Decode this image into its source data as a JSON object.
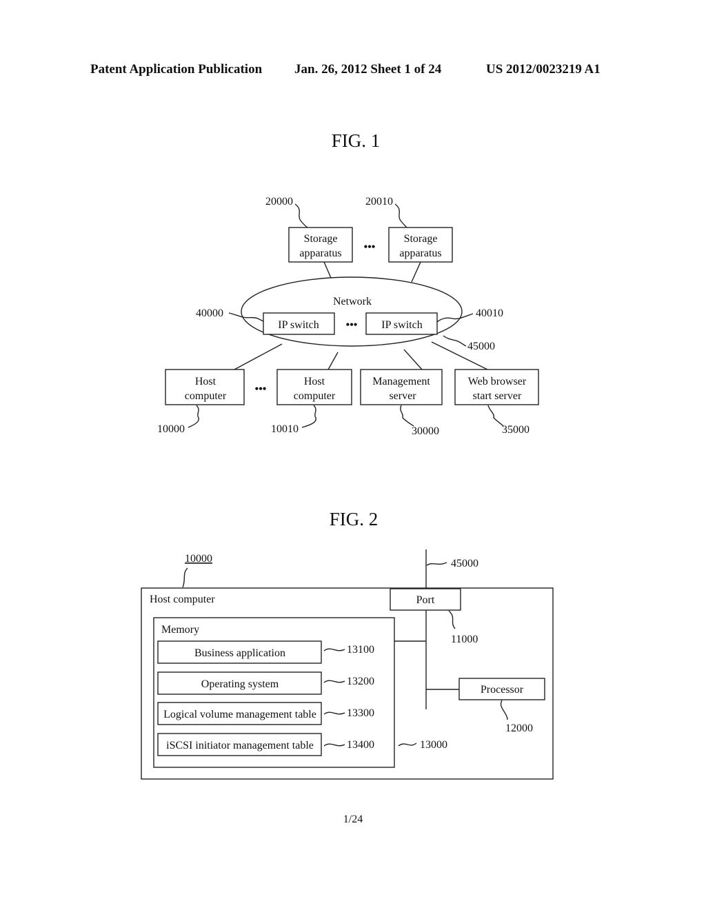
{
  "header": {
    "publication": "Patent Application Publication",
    "date_sheet": "Jan. 26, 2012  Sheet 1 of 24",
    "number": "US 2012/0023219 A1"
  },
  "fig1": {
    "title": "FIG. 1",
    "storage": [
      {
        "line1": "Storage",
        "line2": "apparatus",
        "ref": "20000"
      },
      {
        "line1": "Storage",
        "line2": "apparatus",
        "ref": "20010"
      }
    ],
    "network": {
      "label": "Network",
      "ref": "45000"
    },
    "switches": [
      {
        "label": "IP switch",
        "ref": "40000"
      },
      {
        "label": "IP switch",
        "ref": "40010"
      }
    ],
    "nodes": [
      {
        "line1": "Host",
        "line2": "computer",
        "ref": "10000"
      },
      {
        "line1": "Host",
        "line2": "computer",
        "ref": "10010"
      },
      {
        "line1": "Management",
        "line2": "server",
        "ref": "30000"
      },
      {
        "line1": "Web browser",
        "line2": "start server",
        "ref": "35000"
      }
    ],
    "ellipsis": "•••"
  },
  "fig2": {
    "title": "FIG. 2",
    "host": {
      "label": "Host computer",
      "ref": "10000"
    },
    "port": {
      "label": "Port",
      "ref": "11000"
    },
    "network_ref": "45000",
    "processor": {
      "label": "Processor",
      "ref": "12000"
    },
    "memory": {
      "label": "Memory",
      "ref": "13000",
      "items": [
        {
          "label": "Business application",
          "ref": "13100"
        },
        {
          "label": "Operating system",
          "ref": "13200"
        },
        {
          "label": "Logical volume management table",
          "ref": "13300"
        },
        {
          "label": "iSCSI initiator management table",
          "ref": "13400"
        }
      ]
    }
  },
  "footer": {
    "page": "1/24"
  }
}
